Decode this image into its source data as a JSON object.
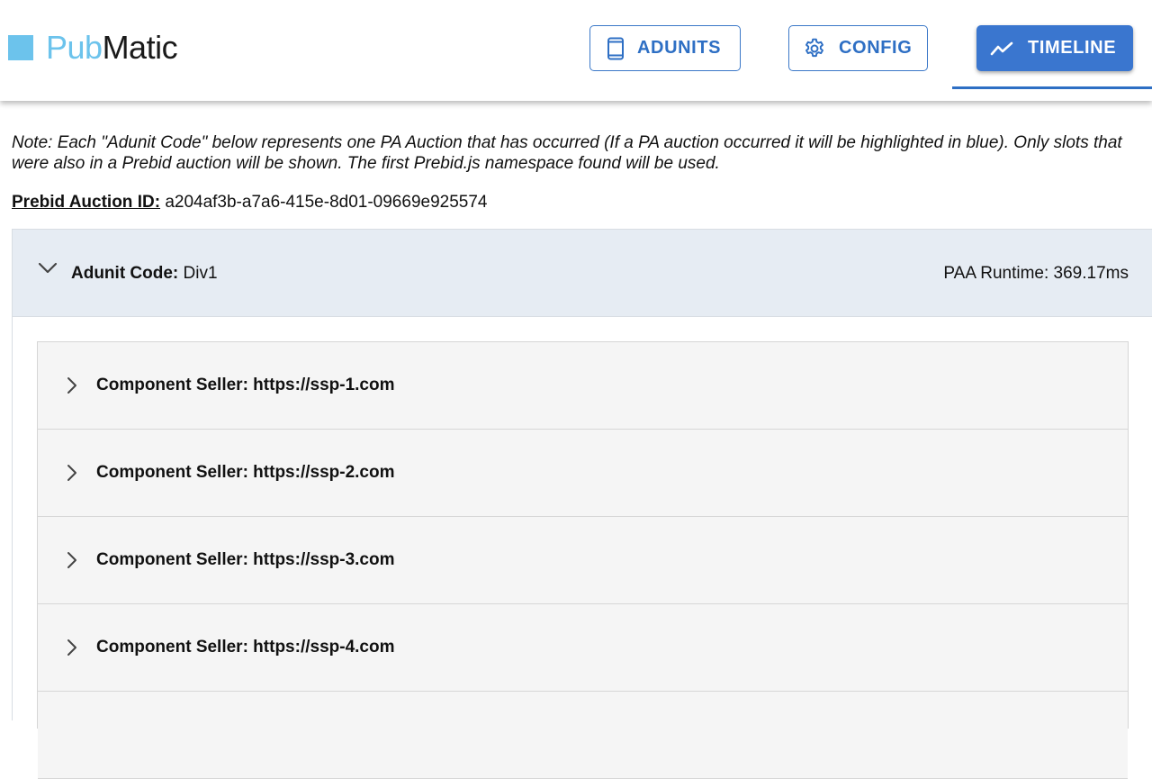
{
  "header": {
    "logo": {
      "pub": "Pub",
      "matic": "Matic"
    },
    "nav": [
      {
        "label": "ADUNITS",
        "icon": "phone-icon"
      },
      {
        "label": "CONFIG",
        "icon": "gear-icon"
      },
      {
        "label": "TIMELINE",
        "icon": "trending-up-icon",
        "active": true
      }
    ]
  },
  "note": "Note: Each \"Adunit Code\" below represents one PA Auction that has occurred (If a PA auction occurred it will be highlighted in blue). Only slots that were also in a Prebid auction will be shown. The first Prebid.js namespace found will be used.",
  "auction": {
    "label": "Prebid Auction ID:",
    "id": "a204af3b-a7a6-415e-8d01-09669e925574"
  },
  "adunit": {
    "code_label": "Adunit Code:",
    "code": "Div1",
    "runtime": "PAA Runtime: 369.17ms",
    "sellers": [
      {
        "label": "Component Seller: https://ssp-1.com"
      },
      {
        "label": "Component Seller: https://ssp-2.com"
      },
      {
        "label": "Component Seller: https://ssp-3.com"
      },
      {
        "label": "Component Seller: https://ssp-4.com"
      },
      {
        "label": ""
      }
    ]
  },
  "colors": {
    "accent": "#3a76cf",
    "logo_blue": "#6cc3ec",
    "adunit_header_bg": "#e6ecf3",
    "seller_bg": "#f5f5f5"
  }
}
